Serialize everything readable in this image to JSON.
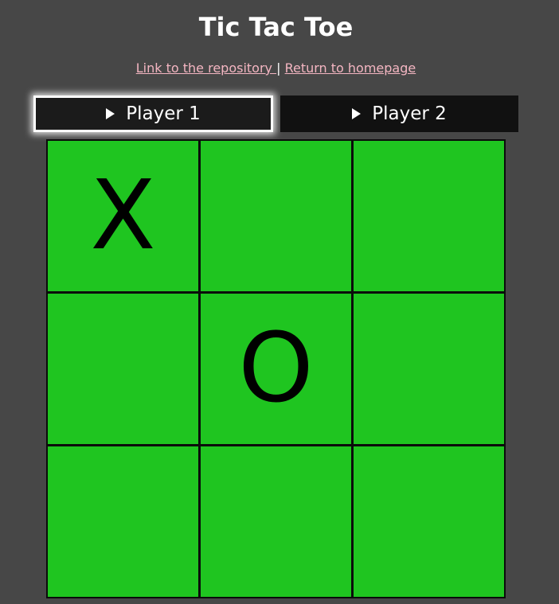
{
  "title": "Tic Tac Toe",
  "links": {
    "repository": "Link to the repository ",
    "separator": "|",
    "homepage": "Return to homepage"
  },
  "players": {
    "player1": "Player 1",
    "player2": "Player 2",
    "active": "player1"
  },
  "board": {
    "cells": [
      "X",
      "",
      "",
      "",
      "O",
      "",
      "",
      "",
      ""
    ]
  },
  "colors": {
    "background": "#474747",
    "cell": "#1fc520",
    "link": "#f4b6c2",
    "button": "#111111"
  }
}
